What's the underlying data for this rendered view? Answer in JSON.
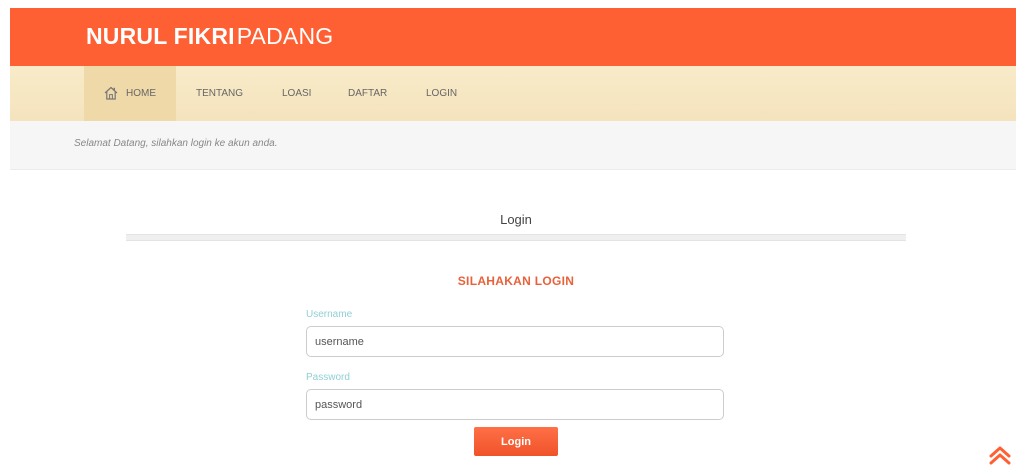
{
  "header": {
    "brand_bold": "NURUL FIKRI",
    "brand_light": "PADANG",
    "background_color": "#ff6033"
  },
  "nav": {
    "items": [
      {
        "label": "HOME",
        "icon": "home-icon",
        "active": true
      },
      {
        "label": "TENTANG"
      },
      {
        "label": "LOASI"
      },
      {
        "label": "DAFTAR"
      },
      {
        "label": "LOGIN"
      }
    ]
  },
  "welcome": {
    "text": "Selamat Datang, silahkan login ke akun anda."
  },
  "section": {
    "title": "Login"
  },
  "form": {
    "heading": "SILAHAKAN LOGIN",
    "username_label": "Username",
    "username_placeholder": "username",
    "password_label": "Password",
    "password_placeholder": "password",
    "submit_label": "Login",
    "accent_color": "#ff5f33"
  },
  "scroll_top": {
    "icon": "double-chevron-up-icon",
    "color": "#ff6033"
  }
}
